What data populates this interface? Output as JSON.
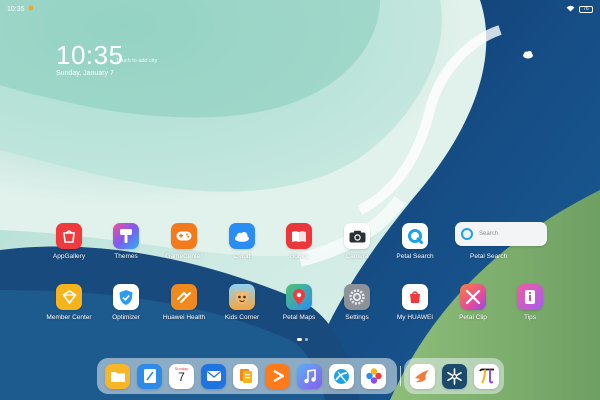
{
  "status_bar": {
    "time": "10:35",
    "battery": "76"
  },
  "clock_widget": {
    "time": "10:35",
    "date": "Sunday, January 7",
    "touch_hint": "Touch to add city"
  },
  "apps_row1": [
    {
      "label": "AppGallery",
      "icon": "appgallery-icon",
      "color": "#ef3a3e"
    },
    {
      "label": "Themes",
      "icon": "themes-icon",
      "color": "#7b5cf0"
    },
    {
      "label": "GameCenter",
      "icon": "gamecenter-icon",
      "color": "#f37a1c"
    },
    {
      "label": "Cloud",
      "icon": "cloud-icon",
      "color": "#2a8df3"
    },
    {
      "label": "Books",
      "icon": "books-icon",
      "color": "#e9373b"
    },
    {
      "label": "Camera",
      "icon": "camera-icon",
      "color": "#ffffff"
    },
    {
      "label": "Petal Search",
      "icon": "petal-search-icon",
      "color": "#ffffff"
    }
  ],
  "search_widget": {
    "placeholder": "Search",
    "label": "Petal Search"
  },
  "apps_row2": [
    {
      "label": "Member Center",
      "icon": "member-center-icon",
      "color": "#f5b31c"
    },
    {
      "label": "Optimizer",
      "icon": "optimizer-icon",
      "color": "#2d9bf0"
    },
    {
      "label": "Huawei Health",
      "icon": "huawei-health-icon",
      "color": "#f08a1e"
    },
    {
      "label": "Kids Corner",
      "icon": "kids-corner-icon",
      "color": "#f7a43a"
    },
    {
      "label": "Petal Maps",
      "icon": "petal-maps-icon",
      "color": "#ffffff"
    },
    {
      "label": "Settings",
      "icon": "settings-icon",
      "color": "#8d9299"
    },
    {
      "label": "My HUAWEI",
      "icon": "my-huawei-icon",
      "color": "#ffffff"
    },
    {
      "label": "Petal Clip",
      "icon": "petal-clip-icon",
      "color": "#e64a9b"
    },
    {
      "label": "Tips",
      "icon": "tips-icon",
      "color": "#f25aa5"
    }
  ],
  "dock": {
    "calendar_day": "Sunday",
    "calendar_date": "7",
    "items": [
      {
        "name": "files-icon",
        "color": "#f6b627"
      },
      {
        "name": "notepad-icon",
        "color": "#2f8be8"
      },
      {
        "name": "calendar-icon",
        "color": "#ffffff"
      },
      {
        "name": "email-icon",
        "color": "#1f74e0"
      },
      {
        "name": "docs-icon",
        "color": "#f08a1e"
      },
      {
        "name": "video-icon",
        "color": "#ff7a1a"
      },
      {
        "name": "music-icon",
        "color": "#6a7cf5"
      },
      {
        "name": "browser-icon",
        "color": "#ffffff"
      },
      {
        "name": "gallery-icon",
        "color": "#ffffff"
      }
    ],
    "recent": [
      {
        "name": "swift-icon",
        "color": "#ffffff"
      },
      {
        "name": "snowflake-icon",
        "color": "#1c4a6b"
      },
      {
        "name": "pi-icon",
        "color": "#ffffff"
      }
    ]
  }
}
